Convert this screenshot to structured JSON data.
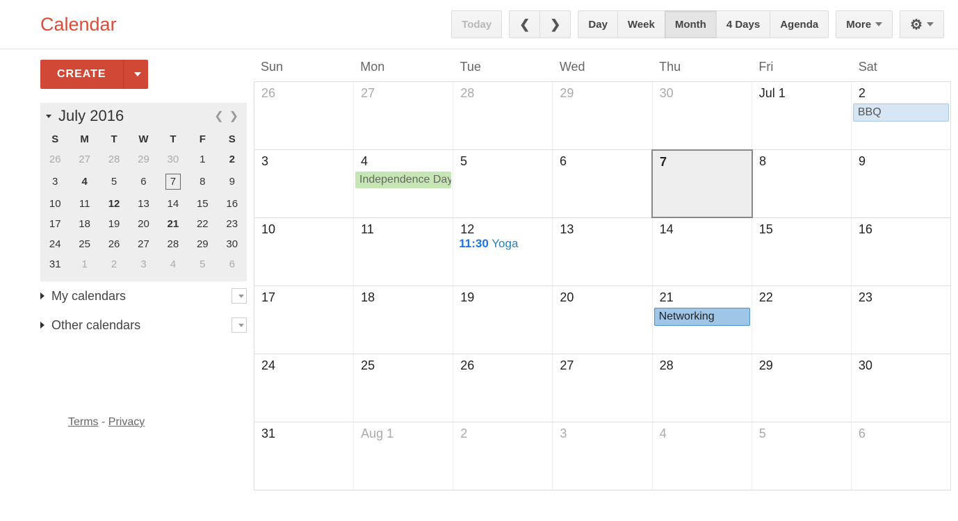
{
  "logo": "Calendar",
  "toolbar": {
    "today": "Today",
    "views": [
      "Day",
      "Week",
      "Month",
      "4 Days",
      "Agenda"
    ],
    "active_view": 2,
    "more": "More"
  },
  "sidebar": {
    "create": "CREATE",
    "mini": {
      "title": "July 2016",
      "dows": [
        "S",
        "M",
        "T",
        "W",
        "T",
        "F",
        "S"
      ],
      "weeks": [
        [
          {
            "n": 26,
            "dim": true
          },
          {
            "n": 27,
            "dim": true
          },
          {
            "n": 28,
            "dim": true
          },
          {
            "n": 29,
            "dim": true
          },
          {
            "n": 30,
            "dim": true
          },
          {
            "n": 1
          },
          {
            "n": 2,
            "bold": true
          }
        ],
        [
          {
            "n": 3
          },
          {
            "n": 4,
            "bold": true
          },
          {
            "n": 5
          },
          {
            "n": 6
          },
          {
            "n": 7,
            "today": true
          },
          {
            "n": 8
          },
          {
            "n": 9
          }
        ],
        [
          {
            "n": 10
          },
          {
            "n": 11
          },
          {
            "n": 12,
            "bold": true
          },
          {
            "n": 13
          },
          {
            "n": 14
          },
          {
            "n": 15
          },
          {
            "n": 16
          }
        ],
        [
          {
            "n": 17
          },
          {
            "n": 18
          },
          {
            "n": 19
          },
          {
            "n": 20
          },
          {
            "n": 21,
            "bold": true
          },
          {
            "n": 22
          },
          {
            "n": 23
          }
        ],
        [
          {
            "n": 24
          },
          {
            "n": 25
          },
          {
            "n": 26
          },
          {
            "n": 27
          },
          {
            "n": 28
          },
          {
            "n": 29
          },
          {
            "n": 30
          }
        ],
        [
          {
            "n": 31
          },
          {
            "n": 1,
            "dim": true
          },
          {
            "n": 2,
            "dim": true
          },
          {
            "n": 3,
            "dim": true
          },
          {
            "n": 4,
            "dim": true
          },
          {
            "n": 5,
            "dim": true
          },
          {
            "n": 6,
            "dim": true
          }
        ]
      ]
    },
    "my_calendars": "My calendars",
    "other_calendars": "Other calendars",
    "footer": {
      "terms": "Terms",
      "sep": " - ",
      "privacy": "Privacy"
    }
  },
  "grid": {
    "daynames": [
      "Sun",
      "Mon",
      "Tue",
      "Wed",
      "Thu",
      "Fri",
      "Sat"
    ],
    "weeks": [
      [
        {
          "label": "26",
          "dim": true
        },
        {
          "label": "27",
          "dim": true
        },
        {
          "label": "28",
          "dim": true
        },
        {
          "label": "29",
          "dim": true
        },
        {
          "label": "30",
          "dim": true
        },
        {
          "label": "Jul 1"
        },
        {
          "label": "2",
          "events": [
            {
              "kind": "blue-light",
              "title": "BBQ"
            }
          ]
        }
      ],
      [
        {
          "label": "3"
        },
        {
          "label": "4",
          "events": [
            {
              "kind": "green",
              "title": "Independence Day"
            }
          ]
        },
        {
          "label": "5"
        },
        {
          "label": "6"
        },
        {
          "label": "7",
          "today": true
        },
        {
          "label": "8"
        },
        {
          "label": "9"
        }
      ],
      [
        {
          "label": "10"
        },
        {
          "label": "11"
        },
        {
          "label": "12",
          "events": [
            {
              "kind": "timed",
              "time": "11:30",
              "title": "Yoga"
            }
          ]
        },
        {
          "label": "13"
        },
        {
          "label": "14"
        },
        {
          "label": "15"
        },
        {
          "label": "16"
        }
      ],
      [
        {
          "label": "17"
        },
        {
          "label": "18"
        },
        {
          "label": "19"
        },
        {
          "label": "20"
        },
        {
          "label": "21",
          "events": [
            {
              "kind": "blue",
              "title": "Networking"
            }
          ]
        },
        {
          "label": "22"
        },
        {
          "label": "23"
        }
      ],
      [
        {
          "label": "24"
        },
        {
          "label": "25"
        },
        {
          "label": "26"
        },
        {
          "label": "27"
        },
        {
          "label": "28"
        },
        {
          "label": "29"
        },
        {
          "label": "30"
        }
      ],
      [
        {
          "label": "31"
        },
        {
          "label": "Aug 1",
          "dim": true
        },
        {
          "label": "2",
          "dim": true
        },
        {
          "label": "3",
          "dim": true
        },
        {
          "label": "4",
          "dim": true
        },
        {
          "label": "5",
          "dim": true
        },
        {
          "label": "6",
          "dim": true
        }
      ]
    ]
  }
}
